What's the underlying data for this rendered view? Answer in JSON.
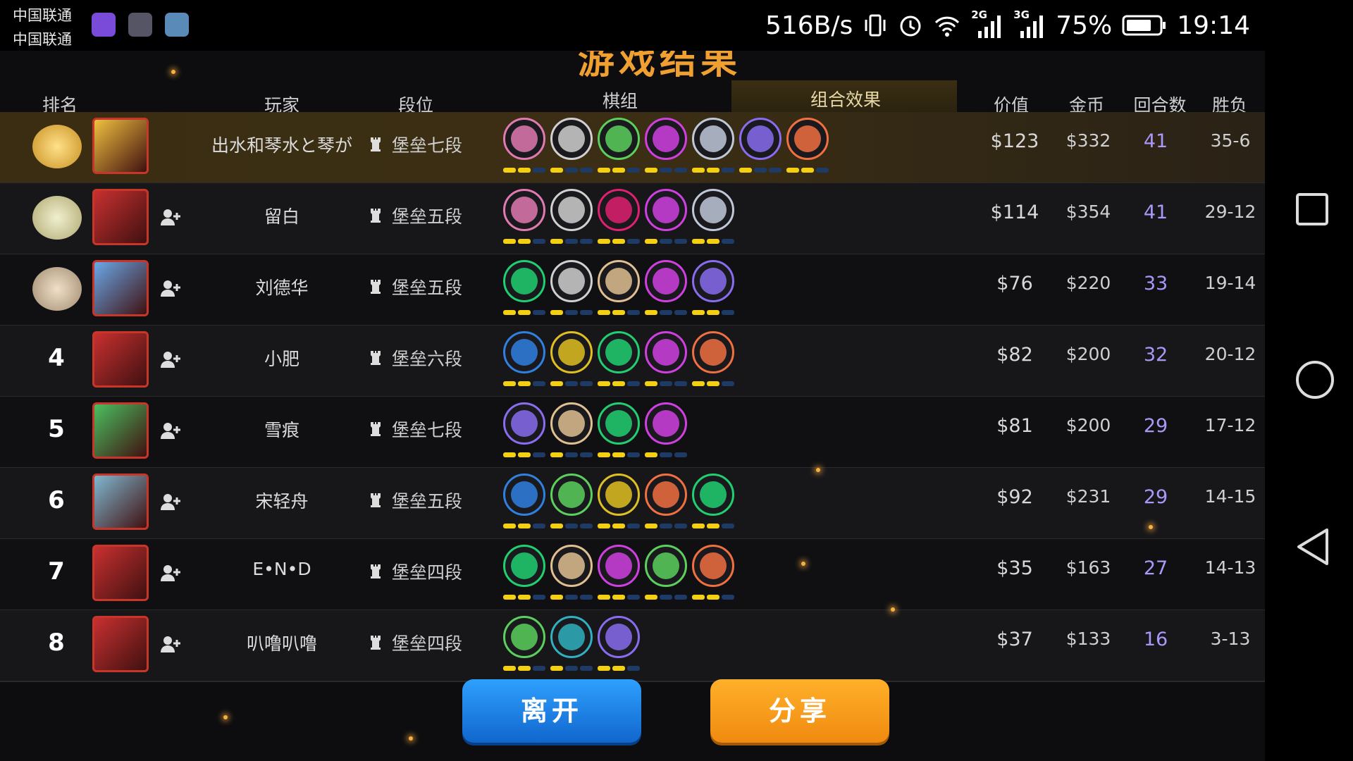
{
  "status_bar": {
    "carrier1": "中国联通",
    "carrier2": "中国联通",
    "net_speed": "516B/s",
    "network1": "2G",
    "network2": "3G",
    "battery": "75%",
    "time": "19:14"
  },
  "title": "游戏结果",
  "headers": {
    "rank": "排名",
    "player": "玩家",
    "tier": "段位",
    "lineup": "棋组",
    "synergy": "组合效果",
    "value": "价值",
    "gold": "金币",
    "rounds": "回合数",
    "record": "胜负"
  },
  "rows": [
    {
      "rank": "1",
      "medal": "gold-medal-icon",
      "name": "出水和琴水と琴が",
      "tier": "堡垒七段",
      "value": "$123",
      "gold": "$332",
      "rounds": "41",
      "record": "35-6",
      "combos": [
        "horse-icon",
        "helmet-icon",
        "bow-icon",
        "demon-icon",
        "paw-cluster-icon",
        "book-icon",
        "viking-icon"
      ],
      "colors": [
        "#e07ab0",
        "#d0d0d0",
        "#5cd05c",
        "#d040e0",
        "#c0c8d8",
        "#8a6cf0",
        "#f07040"
      ]
    },
    {
      "rank": "2",
      "medal": "silver-medal-icon",
      "name": "留白",
      "tier": "堡垒五段",
      "value": "$114",
      "gold": "$354",
      "rounds": "41",
      "record": "29-12",
      "combos": [
        "horse-icon",
        "helmet-icon",
        "dragon-icon",
        "demon-icon",
        "paw-cluster-icon"
      ],
      "colors": [
        "#e07ab0",
        "#d0d0d0",
        "#e02070",
        "#d040e0",
        "#c0c8d8"
      ]
    },
    {
      "rank": "3",
      "medal": "bronze-medal-icon",
      "name": "刘德华",
      "tier": "堡垒五段",
      "value": "$76",
      "gold": "$220",
      "rounds": "33",
      "record": "19-14",
      "combos": [
        "paw-icon",
        "helmet-icon",
        "axe-icon",
        "demon-icon",
        "fishbone-icon"
      ],
      "colors": [
        "#20d070",
        "#d0d0d0",
        "#e0c090",
        "#d040e0",
        "#8a6cf0"
      ]
    },
    {
      "rank": "4",
      "medal": "",
      "name": "小肥",
      "tier": "堡垒六段",
      "value": "$82",
      "gold": "$200",
      "rounds": "32",
      "record": "20-12",
      "combos": [
        "feather-icon",
        "claw-icon",
        "paw-icon",
        "demon-icon",
        "leaf-icon"
      ],
      "colors": [
        "#3080e0",
        "#e0c020",
        "#20d070",
        "#d040e0",
        "#f07040"
      ]
    },
    {
      "rank": "5",
      "medal": "",
      "name": "雪痕",
      "tier": "堡垒七段",
      "value": "$81",
      "gold": "$200",
      "rounds": "29",
      "record": "17-12",
      "combos": [
        "fishbone-icon",
        "axe-icon",
        "paw-icon",
        "demon-icon"
      ],
      "colors": [
        "#8a6cf0",
        "#e0c090",
        "#20d070",
        "#d040e0"
      ]
    },
    {
      "rank": "6",
      "medal": "",
      "name": "宋轻舟",
      "tier": "堡垒五段",
      "value": "$92",
      "gold": "$231",
      "rounds": "29",
      "record": "14-15",
      "combos": [
        "feather-icon",
        "bow-icon",
        "claw-icon",
        "leaf-icon",
        "paw-icon"
      ],
      "colors": [
        "#3080e0",
        "#5cd05c",
        "#e0c020",
        "#f07040",
        "#20d070"
      ]
    },
    {
      "rank": "7",
      "medal": "",
      "name": "E•N•D",
      "tier": "堡垒四段",
      "value": "$35",
      "gold": "$163",
      "rounds": "27",
      "record": "14-13",
      "combos": [
        "paw-icon",
        "axe-icon",
        "demon-icon",
        "bow-icon",
        "viking-icon"
      ],
      "colors": [
        "#20d070",
        "#e0c090",
        "#d040e0",
        "#5cd05c",
        "#f07040"
      ]
    },
    {
      "rank": "8",
      "medal": "",
      "name": "叭噜叭噜",
      "tier": "堡垒四段",
      "value": "$37",
      "gold": "$133",
      "rounds": "16",
      "record": "3-13",
      "combos": [
        "clover-icon",
        "spirit-icon",
        "book-icon"
      ],
      "colors": [
        "#5cd05c",
        "#30b0c0",
        "#8a6cf0"
      ]
    }
  ],
  "buttons": {
    "leave": "离开",
    "share": "分享"
  }
}
